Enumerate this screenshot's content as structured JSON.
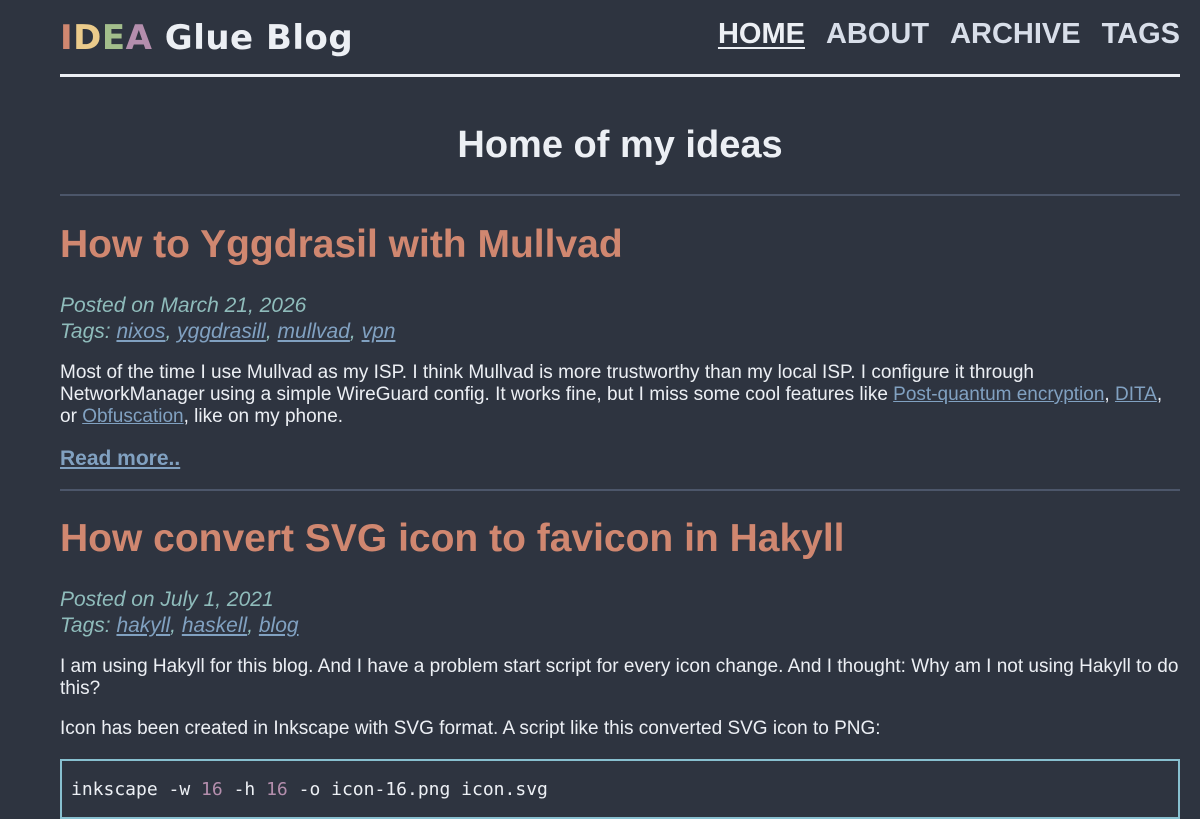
{
  "logo": {
    "letters": [
      {
        "char": "I",
        "color": "#d08770"
      },
      {
        "char": "D",
        "color": "#ebcb8b"
      },
      {
        "char": "E",
        "color": "#a3be8c"
      },
      {
        "char": "A",
        "color": "#b48ead"
      }
    ],
    "rest": " Glue Blog"
  },
  "nav": [
    {
      "label": "HOME",
      "active": true
    },
    {
      "label": "ABOUT",
      "active": false
    },
    {
      "label": "ARCHIVE",
      "active": false
    },
    {
      "label": "TAGS",
      "active": false
    }
  ],
  "page_title": "Home of my ideas",
  "posts": [
    {
      "title": "How to Yggdrasil with Mullvad",
      "posted_prefix": "Posted on ",
      "date": "March 21, 2026",
      "tags_prefix": "Tags: ",
      "tags": [
        "nixos",
        "yggdrasill",
        "mullvad",
        "vpn"
      ],
      "summary_parts": [
        {
          "text": "Most of the time I use Mullvad as my ISP. I think Mullvad is more trustworthy than my local ISP. I configure it through NetworkManager using a simple WireGuard config. It works fine, but I miss some cool features like "
        },
        {
          "link": "Post-quantum encryption"
        },
        {
          "text": ", "
        },
        {
          "link": "DITA"
        },
        {
          "text": ", or "
        },
        {
          "link": "Obfuscation"
        },
        {
          "text": ", like on my phone."
        }
      ],
      "read_more": "Read more.."
    },
    {
      "title": "How convert SVG icon to favicon in Hakyll",
      "posted_prefix": "Posted on ",
      "date": "July 1, 2021",
      "tags_prefix": "Tags: ",
      "tags": [
        "hakyll",
        "haskell",
        "blog"
      ],
      "paragraphs": [
        "I am using Hakyll for this blog. And I have a problem start script for every icon change. And I thought: Why am I not using Hakyll to do this?",
        "Icon has been created in Inkscape with SVG format. A script like this converted SVG icon to PNG:"
      ],
      "code_tokens": [
        {
          "t": "inkscape -w ",
          "k": "plain"
        },
        {
          "t": "16",
          "k": "num"
        },
        {
          "t": " -h ",
          "k": "plain"
        },
        {
          "t": "16",
          "k": "num"
        },
        {
          "t": " -o icon-16.png icon.svg",
          "k": "plain"
        }
      ]
    }
  ]
}
